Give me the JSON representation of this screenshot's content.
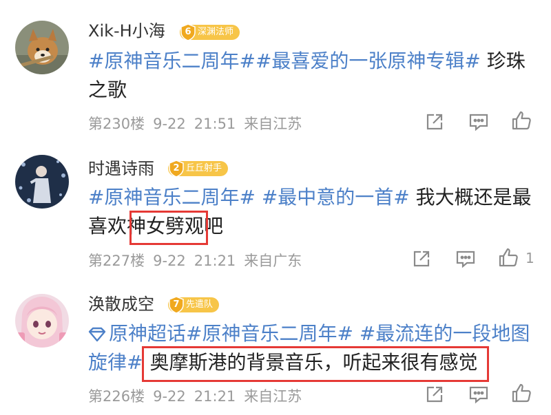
{
  "comments": [
    {
      "username": "Xik-H小海",
      "badge_level": "6",
      "badge_label": "深渊法师",
      "topic1": "#原神音乐二周年#",
      "topic2": "#最喜爱的一张原神专辑#",
      "text": " 珍珠之歌",
      "floor": "第230楼",
      "date": "9-22",
      "time": "21:51",
      "location": "来自江苏",
      "like_count": ""
    },
    {
      "username": "时遇诗雨",
      "badge_level": "2",
      "badge_label": "丘丘射手",
      "topic1": "#原神音乐二周年#",
      "topic2": " #最中意的一首#",
      "text_before": " 我大概还是最喜欢",
      "text_highlight": "神女劈观",
      "text_after": "吧",
      "floor": "第227楼",
      "date": "9-22",
      "time": "21:21",
      "location": "来自广东",
      "like_count": "1"
    },
    {
      "username": "涣散成空",
      "badge_level": "7",
      "badge_label": "先遣队",
      "supertopic": "原神超话",
      "topic1": "#原神音乐二周年#",
      "topic2": " #最流连的一段地图旋律#",
      "text_highlight": "奥摩斯港的背景音乐，听起来很有感觉",
      "floor": "第226楼",
      "date": "9-22",
      "time": "21:21",
      "location": "来自江苏",
      "like_count": ""
    }
  ],
  "icons": {
    "share": "share-icon",
    "comment": "comment-icon",
    "like": "thumbs-up-icon",
    "diamond": "diamond-icon"
  },
  "colors": {
    "topic": "#4c80c8",
    "badge": "#f7c548",
    "highlight": "#e53935",
    "meta": "#9a9a9a"
  }
}
